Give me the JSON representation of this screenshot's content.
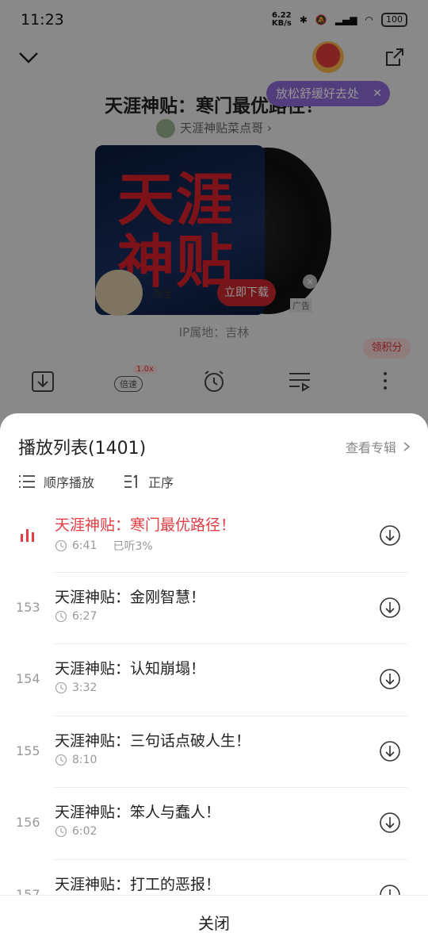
{
  "status_bar": {
    "time": "11:23",
    "net_speed": "6.22",
    "net_unit": "KB/s",
    "battery": "100"
  },
  "player": {
    "episode_title": "天涯神贴：寒门最优路径！",
    "anchor_name": "天涯神贴菜点哥",
    "relax_pill": "放松舒缓好去处",
    "cover_text": "天涯\n神贴",
    "ad": {
      "app": "淘宝",
      "cta": "立即下载",
      "tag": "广告",
      "close": "×"
    },
    "ip_location": "IP属地：吉林",
    "points_button": "领积分",
    "speed_label": "倍速",
    "speed_badge": "1.0x"
  },
  "playlist": {
    "title": "播放列表(1401)",
    "view_album": "查看专辑",
    "mode_label": "顺序播放",
    "order_label": "正序",
    "items": [
      {
        "num": "",
        "title": "天涯神贴：寒门最优路径！",
        "duration": "6:41",
        "progress": "已听3%",
        "active": true
      },
      {
        "num": "153",
        "title": "天涯神贴：金刚智慧！",
        "duration": "6:27",
        "progress": "",
        "active": false
      },
      {
        "num": "154",
        "title": "天涯神贴：认知崩塌！",
        "duration": "3:32",
        "progress": "",
        "active": false
      },
      {
        "num": "155",
        "title": "天涯神贴：三句话点破人生！",
        "duration": "8:10",
        "progress": "",
        "active": false
      },
      {
        "num": "156",
        "title": "天涯神贴：笨人与蠢人！",
        "duration": "6:02",
        "progress": "",
        "active": false
      },
      {
        "num": "157",
        "title": "天涯神贴：打工的恶报！",
        "duration": "",
        "progress": "",
        "active": false
      }
    ],
    "close_label": "关闭"
  },
  "colors": {
    "accent": "#e23d44",
    "overlay": "rgba(0,0,0,0.42)"
  }
}
